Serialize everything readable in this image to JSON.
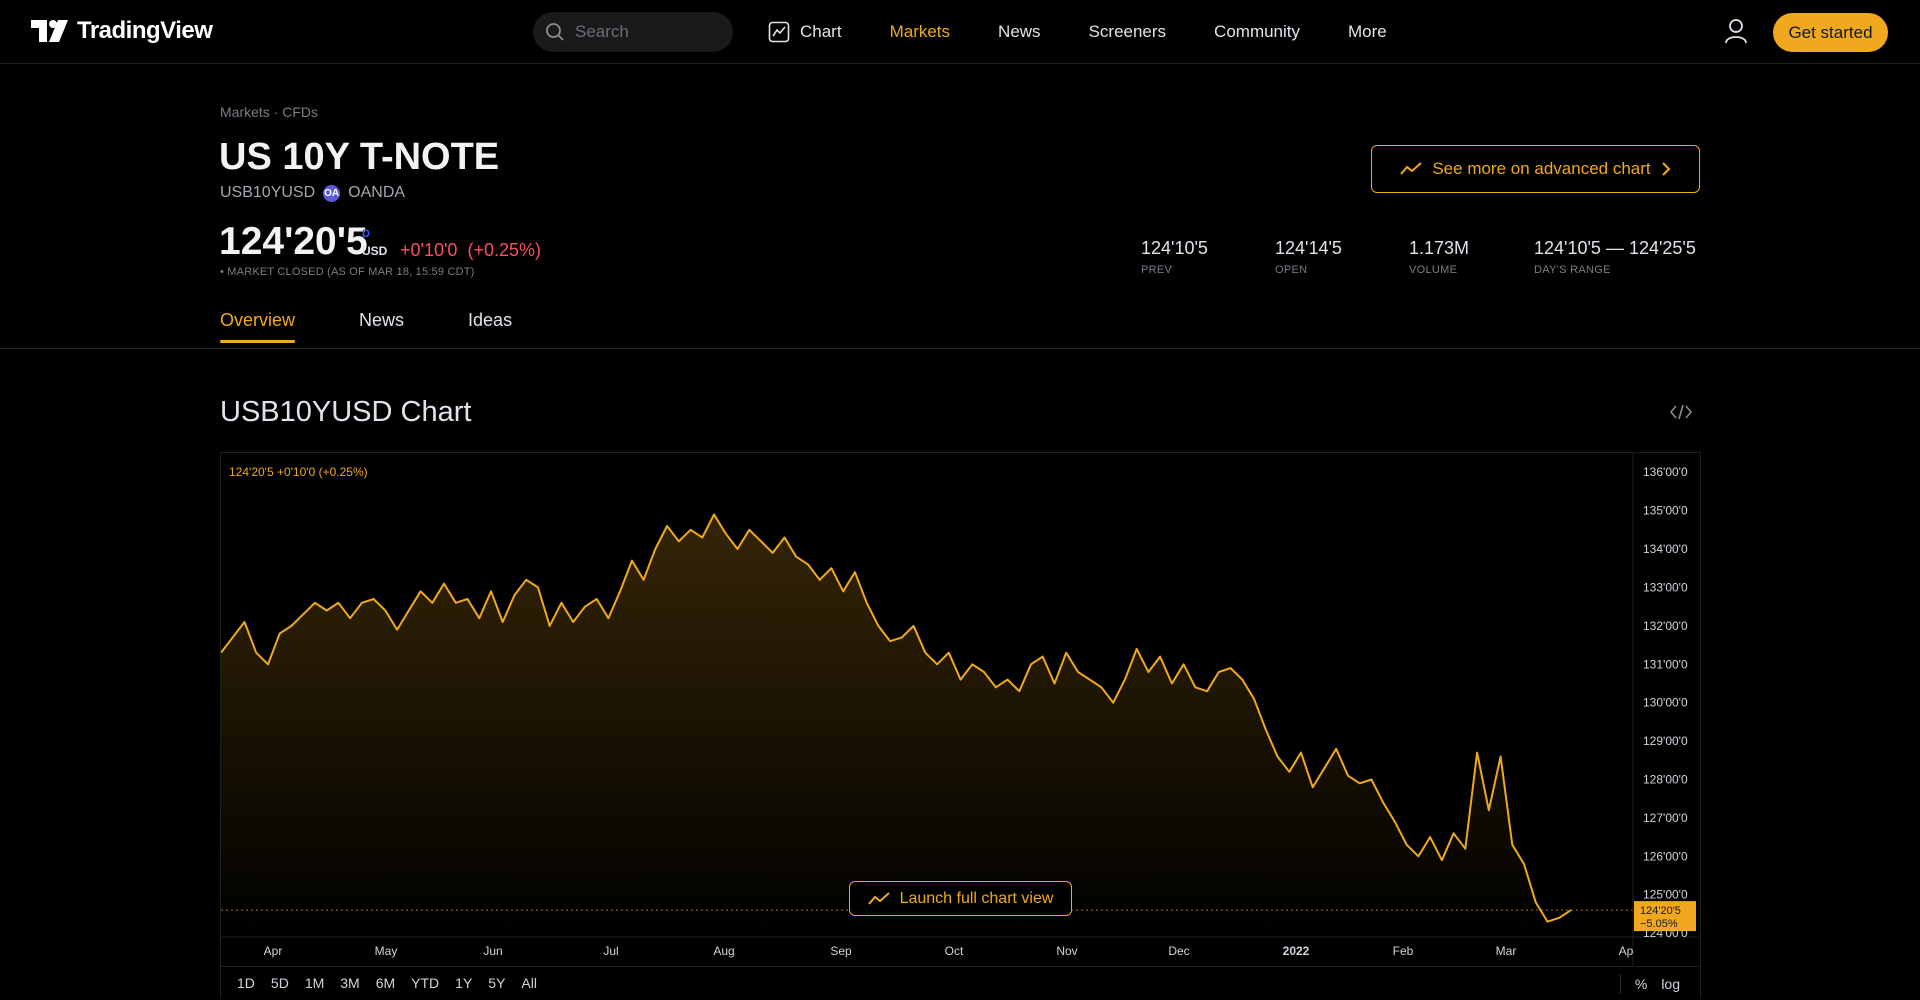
{
  "header": {
    "brand": "TradingView",
    "search_placeholder": "Search",
    "nav": [
      "Chart",
      "Markets",
      "News",
      "Screeners",
      "Community",
      "More"
    ],
    "active_nav": "Markets",
    "cta": "Get started"
  },
  "breadcrumb": "Markets · CFDs",
  "instrument": {
    "name": "US 10Y T-NOTE",
    "symbol": "USB10YUSD",
    "exchange": "OANDA",
    "exchange_logo": "OA",
    "price": "124'20'5",
    "price_interval": "D",
    "currency": "USD",
    "change": "+0'10'0",
    "change_pct": "(+0.25%)",
    "status": "• MARKET CLOSED (AS OF MAR 18, 15:59 CDT)",
    "advanced_chart_label": "See more on advanced chart"
  },
  "stats": [
    {
      "value": "124'10'5",
      "label": "PREV"
    },
    {
      "value": "124'14'5",
      "label": "OPEN"
    },
    {
      "value": "1.173M",
      "label": "VOLUME"
    },
    {
      "value": "124'10'5 — 124'25'5",
      "label": "DAY'S RANGE"
    }
  ],
  "tabs": [
    "Overview",
    "News",
    "Ideas"
  ],
  "chart_section": {
    "title": "USB10YUSD Chart",
    "legend": "124'20'5  +0'10'0 (+0.25%)",
    "launch_label": "Launch full chart view",
    "price_tag": "124'20'5",
    "price_tag_pct": "−5.05%",
    "timeframes": [
      "1D",
      "5D",
      "1M",
      "3M",
      "6M",
      "YTD",
      "1Y",
      "5Y",
      "All"
    ],
    "scale_options": [
      "%",
      "log"
    ],
    "accent": "#f0a91e"
  },
  "chart_data": {
    "type": "area",
    "x_labels": [
      "Apr",
      "May",
      "Jun",
      "Jul",
      "Aug",
      "Sep",
      "Oct",
      "Nov",
      "Dec",
      "2022",
      "Feb",
      "Mar",
      "Ap"
    ],
    "y_ticks": [
      "136'00'0",
      "135'00'0",
      "134'00'0",
      "133'00'0",
      "132'00'0",
      "131'00'0",
      "130'00'0",
      "129'00'0",
      "128'00'0",
      "127'00'0",
      "126'00'0",
      "125'00'0",
      "124'00'0"
    ],
    "ylim": [
      123.9,
      136.5
    ],
    "values": [
      131.3,
      131.7,
      132.1,
      131.3,
      131.0,
      131.8,
      132.0,
      132.3,
      132.6,
      132.4,
      132.6,
      132.2,
      132.6,
      132.7,
      132.4,
      131.9,
      132.4,
      132.9,
      132.6,
      133.1,
      132.6,
      132.7,
      132.2,
      132.9,
      132.1,
      132.8,
      133.2,
      133.0,
      132.0,
      132.6,
      132.1,
      132.5,
      132.7,
      132.2,
      132.9,
      133.7,
      133.2,
      134.0,
      134.6,
      134.2,
      134.5,
      134.3,
      134.9,
      134.4,
      134.0,
      134.5,
      134.2,
      133.9,
      134.3,
      133.8,
      133.6,
      133.2,
      133.5,
      132.9,
      133.4,
      132.6,
      132.0,
      131.6,
      131.7,
      132.0,
      131.3,
      131.0,
      131.3,
      130.6,
      131.0,
      130.8,
      130.4,
      130.6,
      130.3,
      131.0,
      131.2,
      130.5,
      131.3,
      130.8,
      130.6,
      130.4,
      130.0,
      130.6,
      131.4,
      130.8,
      131.2,
      130.5,
      131.0,
      130.4,
      130.3,
      130.8,
      130.9,
      130.6,
      130.1,
      129.3,
      128.6,
      128.2,
      128.7,
      127.8,
      128.3,
      128.8,
      128.1,
      127.9,
      128.0,
      127.4,
      126.9,
      126.3,
      126.0,
      126.5,
      125.9,
      126.6,
      126.2,
      128.7,
      127.2,
      128.6,
      126.3,
      125.8,
      124.8,
      124.3,
      124.4,
      124.6
    ],
    "title": "USB10YUSD Chart"
  }
}
